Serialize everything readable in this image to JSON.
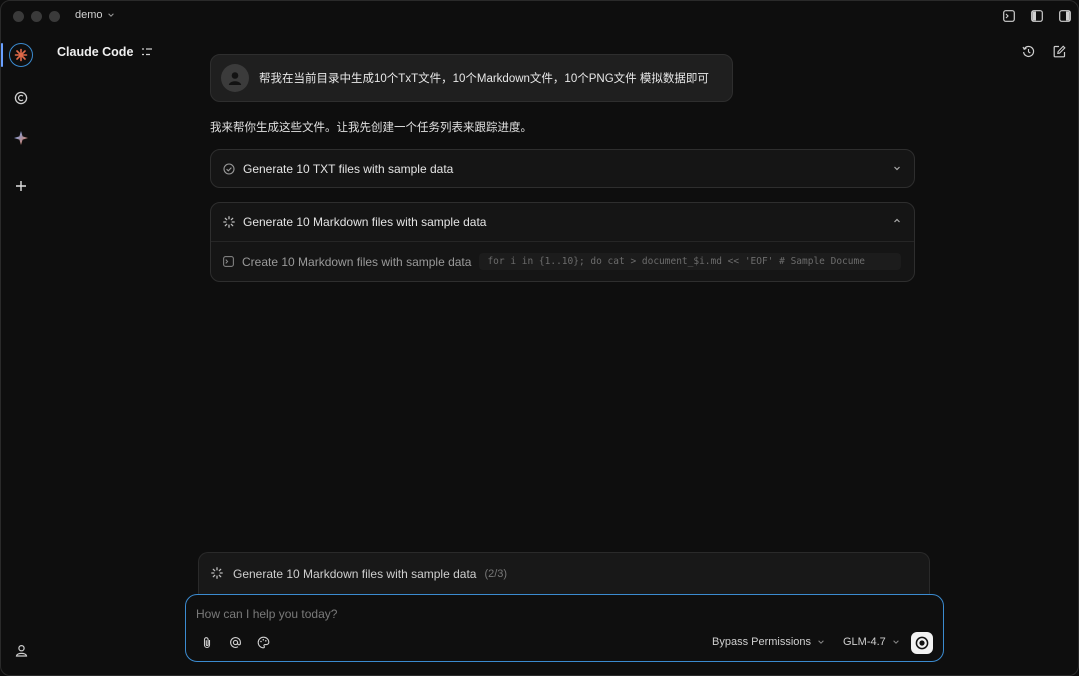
{
  "window": {
    "project_name": "demo"
  },
  "header": {
    "title": "Claude Code"
  },
  "conversation": {
    "user_message": "帮我在当前目录中生成10个TxT文件，10个Markdown文件，10个PNG文件 模拟数据即可",
    "assistant_message": "我来帮你生成这些文件。让我先创建一个任务列表来跟踪进度。",
    "tasks": [
      {
        "label": "Generate 10 TXT files with sample data",
        "status": "done",
        "expanded": false
      },
      {
        "label": "Generate 10 Markdown files with sample data",
        "status": "in-progress",
        "expanded": true,
        "subtask": {
          "label": "Create 10 Markdown files with sample data",
          "command": "for i in {1..10}; do cat > document_$i.md << 'EOF' # Sample Docume"
        }
      }
    ]
  },
  "status": {
    "label": "Generate 10 Markdown files with sample data",
    "count": "(2/3)"
  },
  "composer": {
    "placeholder": "How can I help you today?",
    "permission_mode": "Bypass Permissions",
    "model": "GLM-4.7"
  },
  "colors": {
    "accent": "#3b8bd0",
    "rail_active": "#e06a4a"
  }
}
